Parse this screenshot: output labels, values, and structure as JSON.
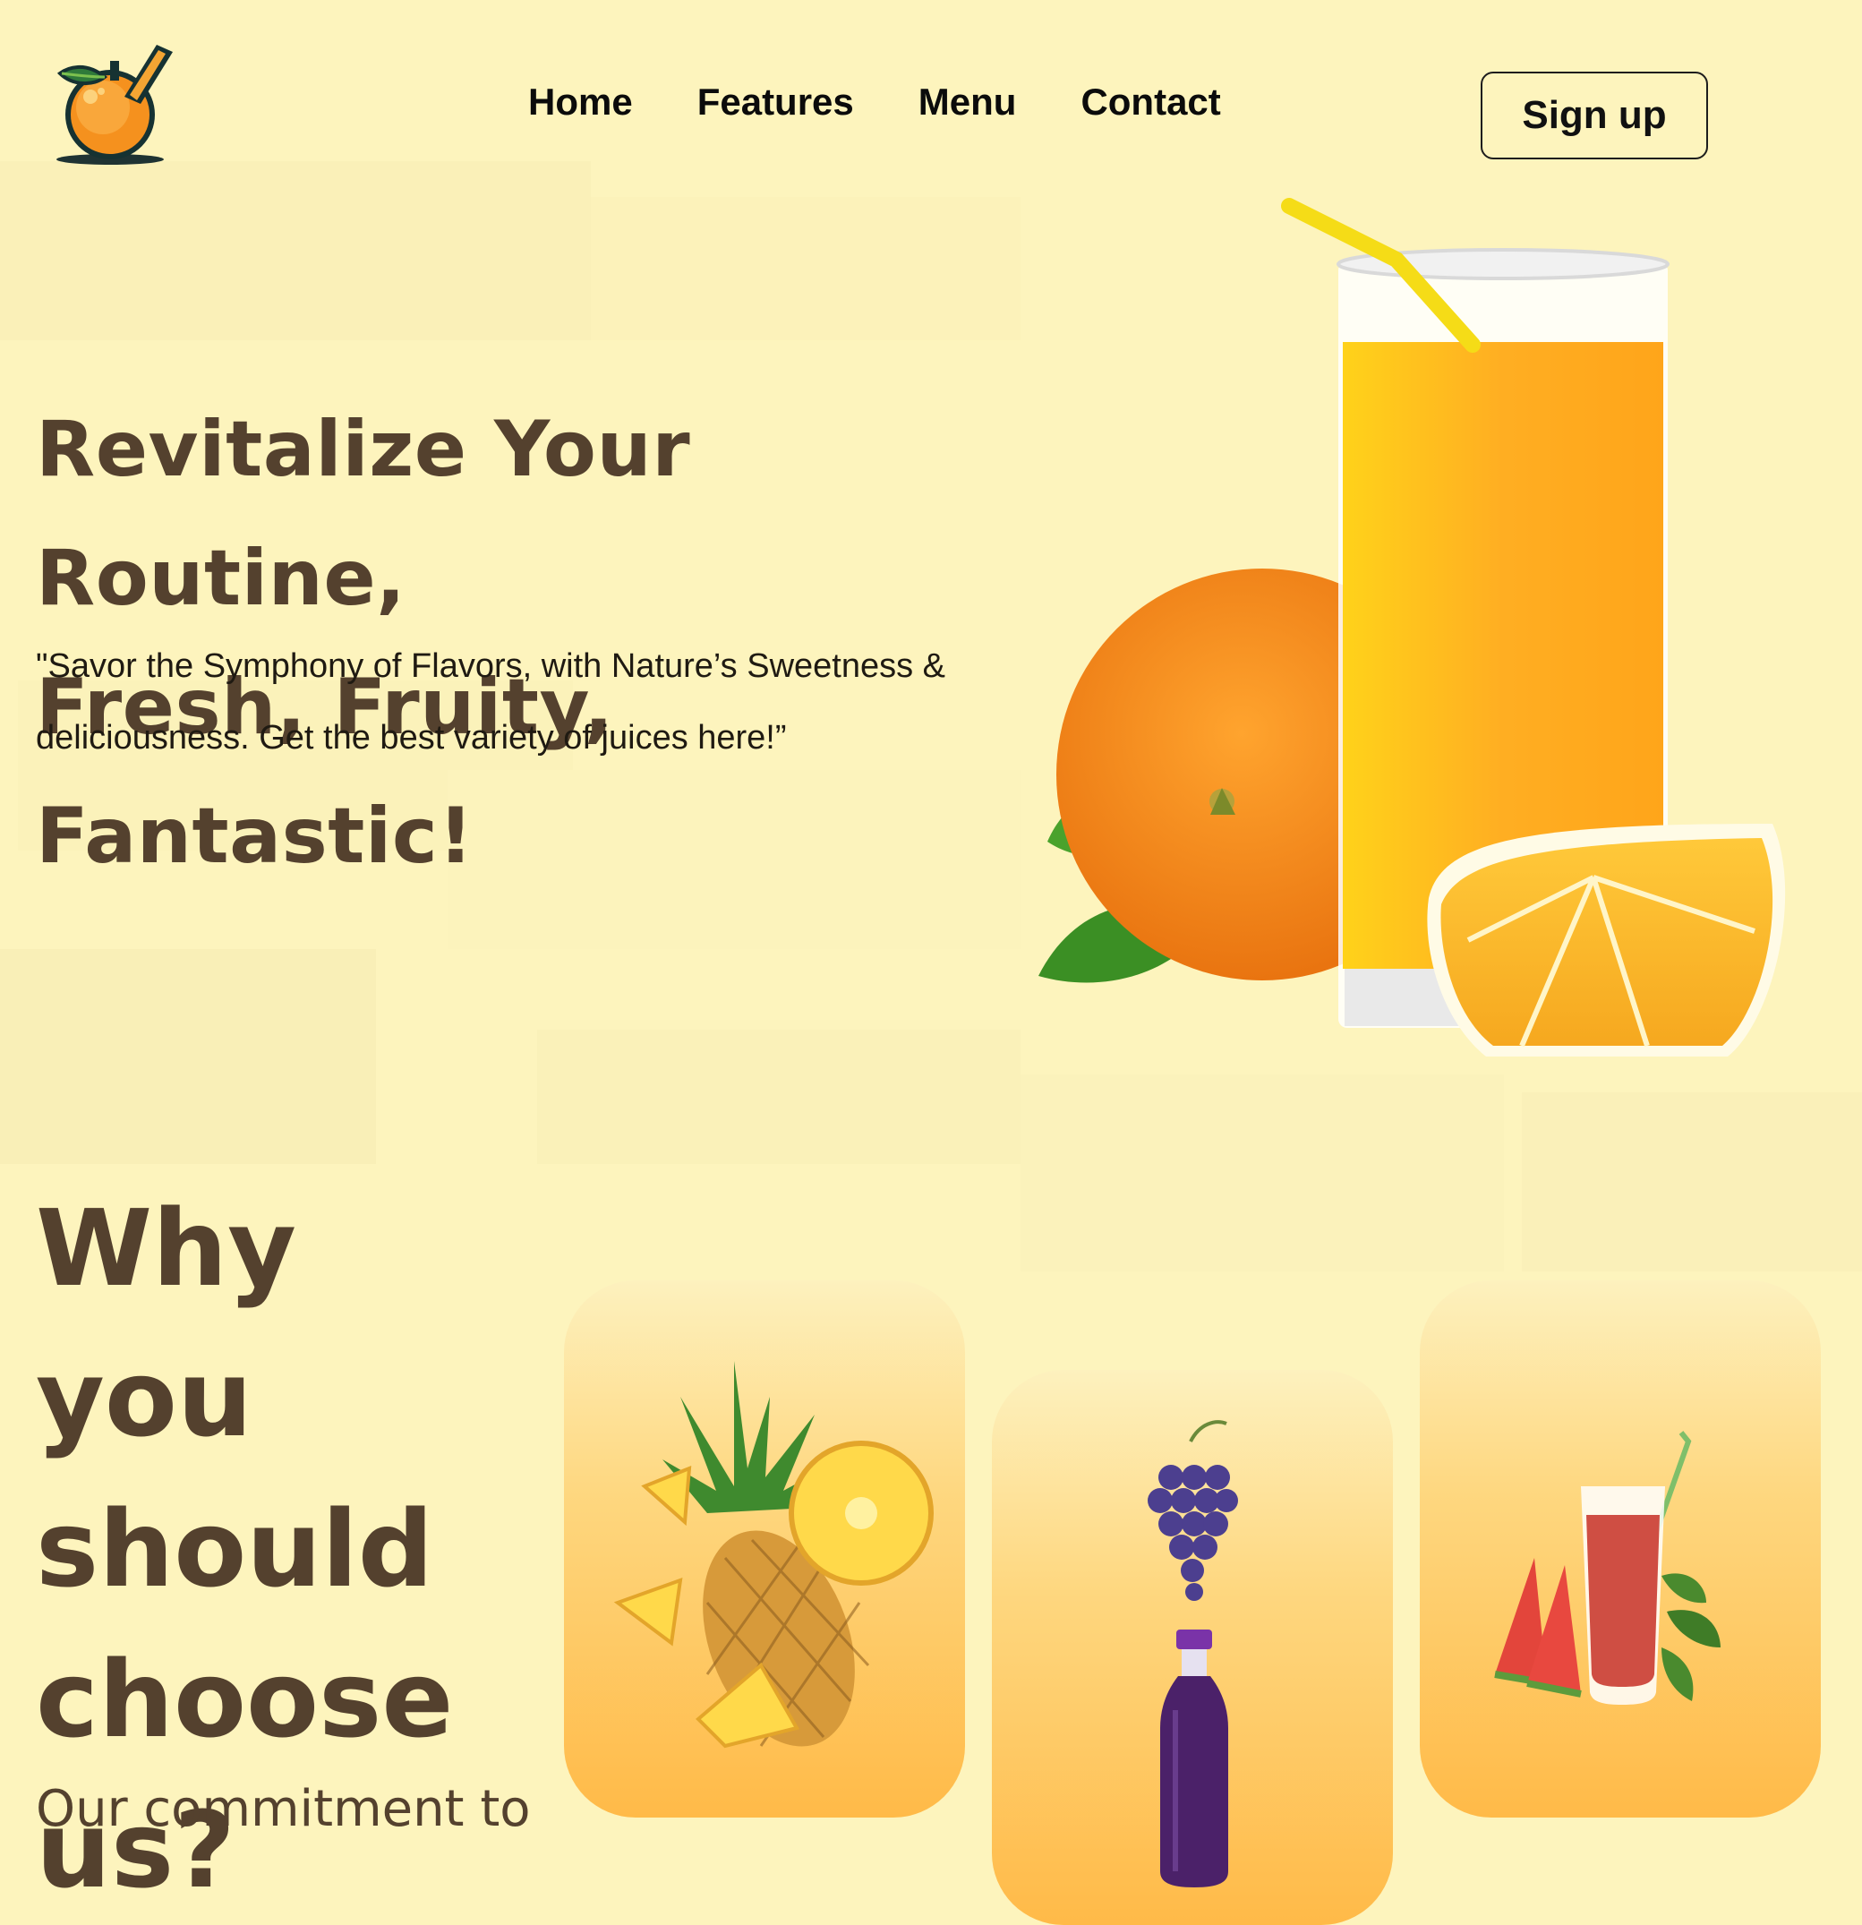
{
  "nav": {
    "items": [
      "Home",
      "Features",
      "Menu",
      "Contact"
    ],
    "signup_label": "Sign up"
  },
  "hero": {
    "title_line1": "Revitalize Your Routine,",
    "title_line2": "Fresh, Fruity, Fantastic!",
    "subtitle_line1": "\"Savor the Symphony of Flavors, with Nature’s Sweetness &",
    "subtitle_line2": "deliciousness. Get the best variety of juices here!”"
  },
  "why": {
    "title_lines": [
      "Why you",
      "should",
      "choose",
      "us?"
    ],
    "subtitle": "Our commitment to"
  },
  "cards": [
    {
      "name": "pineapple-card",
      "icon": "pineapple-icon"
    },
    {
      "name": "grape-juice-card",
      "icon": "grape-bottle-icon"
    },
    {
      "name": "watermelon-juice-card",
      "icon": "watermelon-glass-icon"
    }
  ],
  "colors": {
    "background": "#fdf4bd",
    "heading": "#54412e",
    "card_gradient_top": "#fdf1be",
    "card_gradient_bottom": "#ffba48",
    "juice": "#ffa91c"
  }
}
